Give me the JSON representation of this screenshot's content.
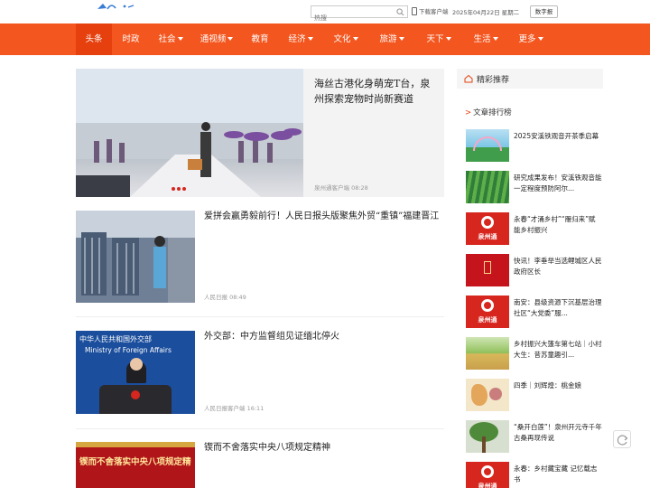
{
  "topbar": {
    "search_placeholder": "热搜",
    "download_label": "下载客户端",
    "date": "2025年04月22日 星期二",
    "digital_paper": "数字报"
  },
  "nav": {
    "items": [
      {
        "label": "头条",
        "dropdown": false,
        "active": true
      },
      {
        "label": "时政",
        "dropdown": false
      },
      {
        "label": "社会",
        "dropdown": true
      },
      {
        "label": "通视频",
        "dropdown": true
      },
      {
        "label": "教育",
        "dropdown": false
      },
      {
        "label": "经济",
        "dropdown": true
      },
      {
        "label": "文化",
        "dropdown": true
      },
      {
        "label": "旅游",
        "dropdown": true
      },
      {
        "label": "天下",
        "dropdown": true
      },
      {
        "label": "生活",
        "dropdown": true
      },
      {
        "label": "更多",
        "dropdown": true
      }
    ]
  },
  "featured": {
    "title": "海丝古港化身萌宠T台，泉州探索宠物时尚新赛道",
    "source": "泉州通客户端",
    "time": "08:28"
  },
  "articles": [
    {
      "title": "爱拼会赢勇毅前行！人民日报头版聚焦外贸“重镇”福建晋江",
      "source": "人民日报",
      "time": "08:49"
    },
    {
      "title": "外交部：中方监督组见证缅北停火",
      "source": "人民日报客户端",
      "time": "16:11"
    },
    {
      "title": "锲而不舍落实中央八项规定精神",
      "banner_text": "锲而不舍落实中央八项规定精神",
      "source": "",
      "time": ""
    }
  ],
  "article2_banner": "中华人民共和国外交部",
  "article2_banner_en": "Ministry of Foreign Affairs",
  "sidebar": {
    "header": "精彩推荐",
    "rank_title": "文章排行榜",
    "items": [
      {
        "title": "2025安溪铁观音开茶季启幕",
        "thumb": "tea-event"
      },
      {
        "title": "研究成果发布！安溪铁观音能一定程度预防阿尔...",
        "thumb": "tea-field"
      },
      {
        "title": "永春“才涌乡村”“雁归来”赋能乡村振兴",
        "thumb": "logo"
      },
      {
        "title": "快讯！李垂举当选鲤城区人民政府区长",
        "thumb": "red-lamp"
      },
      {
        "title": "南安：县级资源下沉基层治理 社区“大党委”服...",
        "thumb": "logo"
      },
      {
        "title": "乡村振兴大篷车第七站｜小村大生：昔苏童趣引...",
        "thumb": "village"
      },
      {
        "title": "四季｜刘辉煌：桃金娘",
        "thumb": "painting"
      },
      {
        "title": "“桑开白莲”！泉州开元寺千年古桑再现传说",
        "thumb": "tree"
      },
      {
        "title": "永春：乡村藏宝藏 记忆载志书",
        "thumb": "logo"
      }
    ],
    "logo_text": "泉州通"
  },
  "colors": {
    "nav": "#f4561f",
    "nav_active": "#e5400e",
    "brand_red": "#d7261e"
  }
}
